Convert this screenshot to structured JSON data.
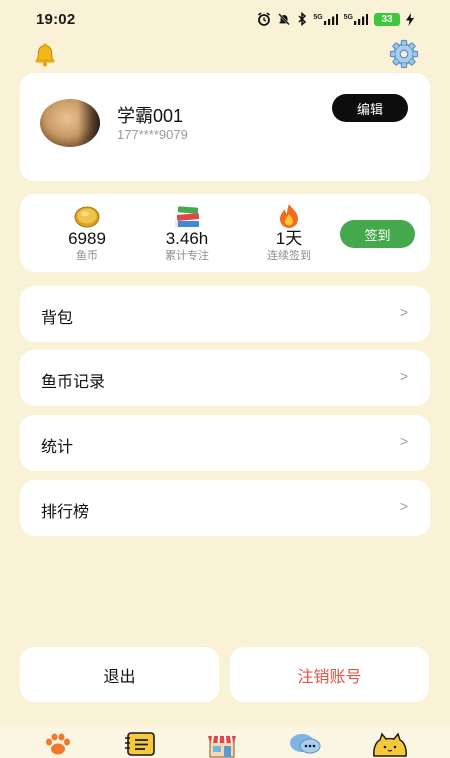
{
  "status_bar": {
    "time": "19:02",
    "signal_1": "5G",
    "signal_2": "5G",
    "battery": "33"
  },
  "profile": {
    "username": "学霸001",
    "phone": "177****9079",
    "edit_label": "编辑"
  },
  "stats": [
    {
      "value": "6989",
      "label": "鱼币",
      "icon": "coin-icon"
    },
    {
      "value": "3.46h",
      "label": "累计专注",
      "icon": "books-icon"
    },
    {
      "value": "1天",
      "label": "连续签到",
      "icon": "fire-icon"
    }
  ],
  "checkin_label": "签到",
  "menu": [
    {
      "label": "背包",
      "chevron": ">"
    },
    {
      "label": "鱼币记录",
      "chevron": ">"
    },
    {
      "label": "统计",
      "chevron": ">"
    },
    {
      "label": "排行榜",
      "chevron": ">"
    }
  ],
  "actions": {
    "logout_label": "退出",
    "delete_account_label": "注销账号"
  },
  "tabs": [
    "paw-icon",
    "notebook-icon",
    "shop-icon",
    "chat-icon",
    "cat-icon"
  ],
  "colors": {
    "background": "#faf2d6",
    "checkin": "#44a84d",
    "danger": "#e15247",
    "edit": "#0d0d0d"
  }
}
